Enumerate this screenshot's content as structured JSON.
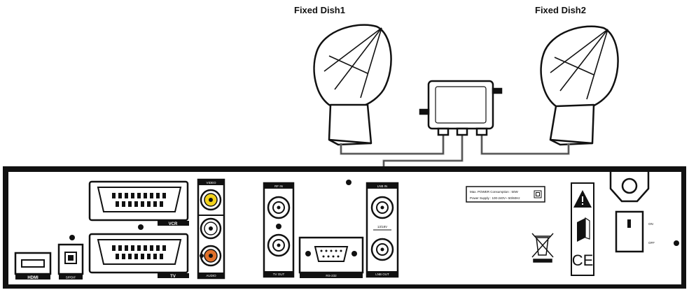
{
  "dishes": [
    {
      "title": "Fixed Dish1"
    },
    {
      "title": "Fixed Dish2"
    }
  ],
  "rear_panel": {
    "ports": {
      "vcr": "VCR",
      "tv": "TV",
      "video": "VIDEO",
      "audio": "AUDIO",
      "spdif": "S/PDIF",
      "hdmi": "HDMI",
      "rf_in": "RF IN",
      "rf_out": "TV OUT",
      "rs232": "RS-232",
      "lnb_in": "LNB IN",
      "lnb_out": "LNB OUT",
      "lnb_mid": "13/18V"
    },
    "power_label": {
      "line1": "Max. POWER Consumption : 50W",
      "line2": "Power Supply : 100-240V~ 50/60Hz"
    },
    "switch": {
      "on": "ON",
      "off": "OFF"
    },
    "ce": "CE"
  },
  "colors": {
    "video_jack": "#f2d21b",
    "audio_left": "#ffffff",
    "audio_right": "#e0702a",
    "line": "#111111",
    "cable": "#888888"
  }
}
